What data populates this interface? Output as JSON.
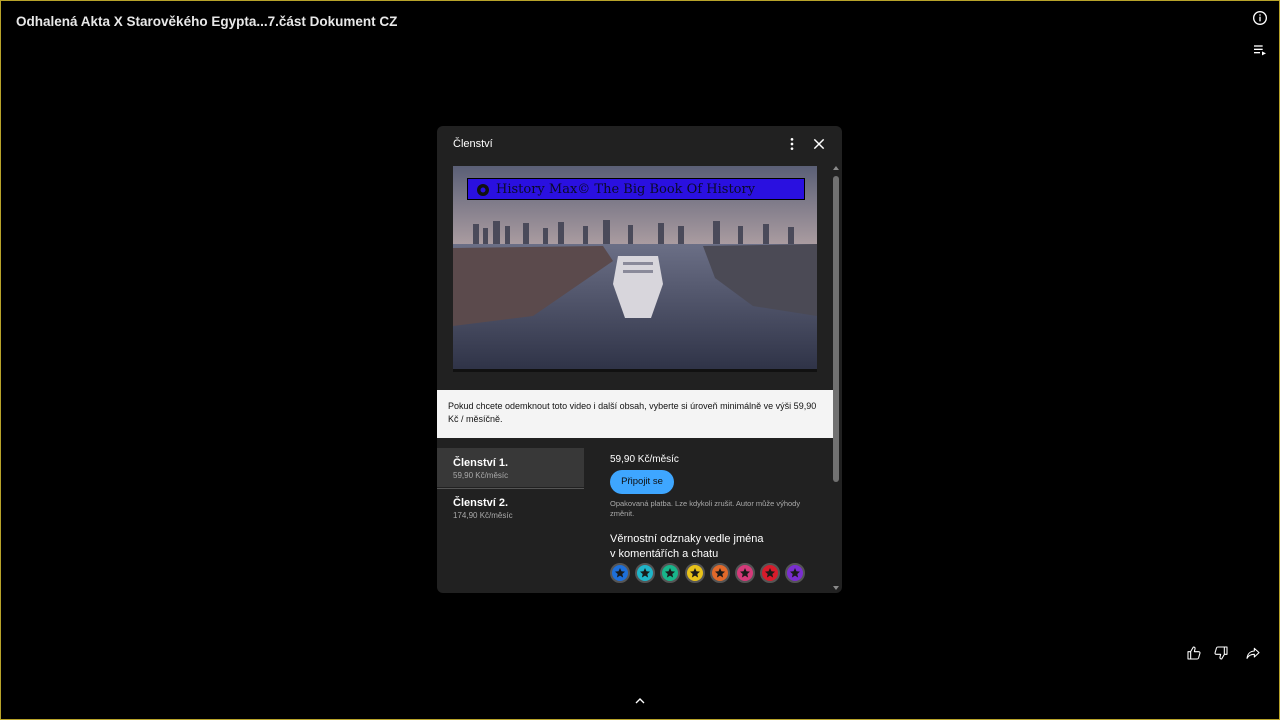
{
  "player": {
    "title": "Odhalená Akta X Starověkého Egypta...7.část Dokument CZ"
  },
  "modal": {
    "title": "Členství",
    "thumbnail_banner_text": "History Max© The Big Book Of History",
    "notice": "Pokud chcete odemknout toto video i další obsah, vyberte si úroveň minimálně ve výši 59,90 Kč / měsíčně.",
    "tiers": [
      {
        "name": "Členství 1.",
        "price": "59,90 Kč/měsíc"
      },
      {
        "name": "Členství 2.",
        "price": "174,90 Kč/měsíc"
      }
    ],
    "detail": {
      "price": "59,90 Kč/měsíc",
      "join_label": "Připojit se",
      "fine_print": "Opakovaná platba. Lze kdykoli zrušit. Autor může výhody změnit.",
      "perk_line1": "Věrnostní odznaky vedle jména",
      "perk_line2": "v komentářích a chatu"
    },
    "badge_colors": [
      "#1e6fd9",
      "#1fb5c9",
      "#18b58a",
      "#e8c21a",
      "#e2692a",
      "#d53a7a",
      "#d81b2b",
      "#7a2ed0"
    ]
  },
  "icons": {
    "info": "info-icon",
    "playlist": "playlist-icon",
    "more": "more-vert-icon",
    "close": "close-icon",
    "like": "thumb-up-icon",
    "dislike": "thumb-down-icon",
    "share": "share-icon",
    "expand": "chevron-up-icon"
  }
}
